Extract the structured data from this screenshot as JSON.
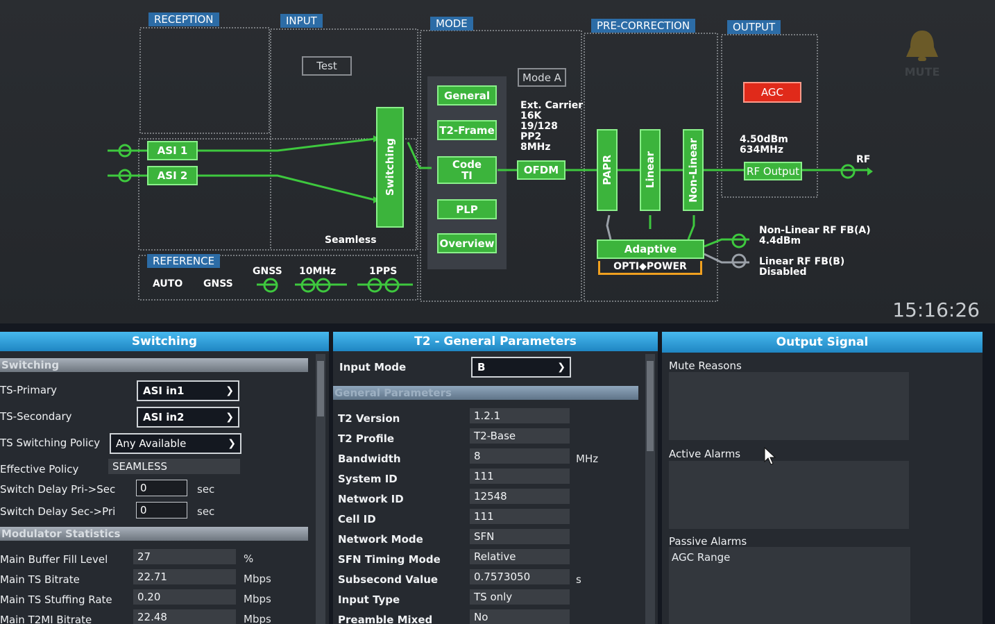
{
  "diagram": {
    "sections": {
      "reception": "RECEPTION",
      "input": "INPUT",
      "mode": "MODE",
      "precorrection": "PRE-CORRECTION",
      "output": "OUTPUT",
      "reference": "REFERENCE"
    },
    "test_button": "Test",
    "asi1": "ASI 1",
    "asi2": "ASI 2",
    "switching": "Switching",
    "seamless": "Seamless",
    "mode_buttons": [
      "General",
      "T2-Frame",
      "Code\nTI",
      "PLP",
      "Overview"
    ],
    "mode_a": "Mode A",
    "ext_carrier": "Ext. Carrier\n16K\n19/128\nPP2\n8MHz",
    "ofdm": "OFDM",
    "papr": "PAPR",
    "linear": "Linear",
    "nonlinear": "Non-Linear",
    "adaptive": "Adaptive",
    "optipower": "OPTI◆POWER",
    "agc": "AGC",
    "output_level": "4.50dBm\n634MHz",
    "rf_output": "RF Output",
    "rf": "RF",
    "nonlinear_fb": "Non-Linear RF FB(A)\n4.4dBm",
    "linear_fb": "Linear RF FB(B)\nDisabled",
    "ref_auto": "AUTO",
    "ref_gnss": "GNSS",
    "gnss": "GNSS",
    "mhz10": "10MHz",
    "pps": "1PPS",
    "mute": "MUTE",
    "clock": "15:16:26"
  },
  "switching_panel": {
    "title": "Switching",
    "section1": "Switching",
    "ts_primary_label": "TS-Primary",
    "ts_primary_value": "ASI in1",
    "ts_secondary_label": "TS-Secondary",
    "ts_secondary_value": "ASI in2",
    "policy_label": "TS Switching Policy",
    "policy_value": "Any Available",
    "effective_label": "Effective Policy",
    "effective_value": "SEAMLESS",
    "delay_ps_label": "Switch Delay Pri->Sec",
    "delay_ps_value": "0",
    "delay_sp_label": "Switch Delay Sec->Pri",
    "delay_sp_value": "0",
    "sec_unit": "sec",
    "section2": "Modulator Statistics",
    "stats": [
      {
        "label": "Main Buffer Fill Level",
        "value": "27",
        "unit": "%"
      },
      {
        "label": "Main TS Bitrate",
        "value": "22.71",
        "unit": "Mbps"
      },
      {
        "label": "Main TS Stuffing Rate",
        "value": "0.20",
        "unit": "Mbps"
      },
      {
        "label": "Main T2MI Bitrate",
        "value": "22.48",
        "unit": "Mbps"
      }
    ]
  },
  "t2_panel": {
    "title": "T2 - General Parameters",
    "input_mode_label": "Input Mode",
    "input_mode_value": "B",
    "section": "General Parameters",
    "params": [
      {
        "label": "T2 Version",
        "value": "1.2.1",
        "unit": ""
      },
      {
        "label": "T2 Profile",
        "value": "T2-Base",
        "unit": ""
      },
      {
        "label": "Bandwidth",
        "value": "8",
        "unit": "MHz"
      },
      {
        "label": "System ID",
        "value": "111",
        "unit": ""
      },
      {
        "label": "Network ID",
        "value": "12548",
        "unit": ""
      },
      {
        "label": "Cell ID",
        "value": "111",
        "unit": ""
      },
      {
        "label": "Network Mode",
        "value": "SFN",
        "unit": ""
      },
      {
        "label": "SFN Timing Mode",
        "value": "Relative",
        "unit": ""
      },
      {
        "label": "Subsecond Value",
        "value": "0.7573050",
        "unit": "s"
      },
      {
        "label": "Input Type",
        "value": "TS only",
        "unit": ""
      },
      {
        "label": "Preamble Mixed",
        "value": "No",
        "unit": ""
      }
    ]
  },
  "output_panel": {
    "title": "Output Signal",
    "mute_reasons": "Mute Reasons",
    "active_alarms": "Active Alarms",
    "passive_alarms": "Passive Alarms",
    "passive_items": [
      "AGC Range"
    ]
  }
}
